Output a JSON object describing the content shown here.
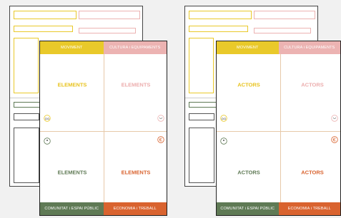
{
  "colors": {
    "movement": "#e9c92a",
    "culture": "#ecb3b2",
    "community": "#5f7a55",
    "economy": "#d9632f",
    "elements_yellow": "#e8c31f",
    "elements_pink": "#ecaeae",
    "elements_green": "#5f7a55",
    "elements_orange": "#d9632f"
  },
  "cards": [
    {
      "top_left_label": "MOVIMENT",
      "top_right_label": "CULTURA i EQUIPAMENTS",
      "bottom_left_label": "COMUNITAT i ESPAI PÚBLIC",
      "bottom_right_label": "ECONOMIA i TREBALL",
      "q1": "ELEMENTS",
      "q2": "ELEMENTS",
      "q3": "ELEMENTS",
      "q4": "ELEMENTS"
    },
    {
      "top_left_label": "MOVIMENT",
      "top_right_label": "CULTURA i EQUIPAMENTS",
      "bottom_left_label": "COMUNITAT i ESPAI PÚBLIC",
      "bottom_right_label": "ECONOMIA i TREBALL",
      "q1": "ACTORS",
      "q2": "ACTORS",
      "q3": "ACTORS",
      "q4": "ACTORS"
    }
  ],
  "icons": [
    "bike-icon",
    "theatre-masks-icon",
    "people-icon",
    "euro-icon"
  ]
}
